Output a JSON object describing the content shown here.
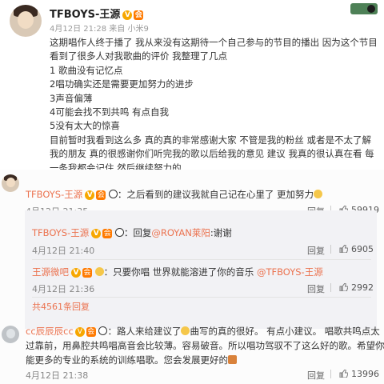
{
  "post": {
    "name": "TFBOYS-王源",
    "meta": "4月12日 21:28 来自 小米9",
    "body": "这期唱作人终于播了 我从来没有这期待一个自己参与的节目的播出 因为这个节目看到了很多人对我歌曲的评价 我整理了几点\n1 歌曲没有记忆点\n2唱功确实还是需要更加努力的进步\n3声音偏薄\n4可能会找不到共鸣 有点自我\n5没有太大的惊喜\n目前暂时我看到这么多 真的真的非常感谢大家 不管是我的粉丝 或者是不太了解我的朋友 真的很感谢你们听完我的歌以后给我的意见 建议 我真的很认真在看 每一条我都会记住 然后继续努力的\nbtw 很多人都说我很刚 那下一期唱作人一定要看哦 我更加__刚"
  },
  "comments": [
    {
      "name": "TFBOYS-王源",
      "text": "：之后看到的建议我就自己记在心里了 更加努力",
      "time": "4月12日 21:35",
      "reply": "回复",
      "likes": "59919"
    }
  ],
  "sub_replies": [
    {
      "name": "TFBOYS-王源",
      "prefix": "：回复",
      "mention": "@ROYAN莱阳",
      "text": ":谢谢",
      "time": "4月12日 21:40",
      "reply": "回复",
      "likes": "6905"
    },
    {
      "name": "王源微吧",
      "text": "：只要你唱 世界就能溶进了你的音乐",
      "mention": "@TFBOYS-王源",
      "time": "4月12日 21:36",
      "reply": "回复",
      "likes": "2992"
    }
  ],
  "more_replies": "共4561条回复",
  "comment2": {
    "name": "cc辰辰辰cc",
    "line1": "：路人来给建议了",
    "line1b": "曲写的真的很好。 有点小建议。 唱歌共鸣点太",
    "line2": "过靠前，用鼻腔共鸣唱高音会比较薄。容易破音。所以唱功驾驭不了这么好的歌。希望你",
    "line3": "能更多的专业的系统的训练唱歌。您会发展更好的",
    "time": "4月12日 21:38",
    "reply": "回复",
    "likes": "13996"
  }
}
